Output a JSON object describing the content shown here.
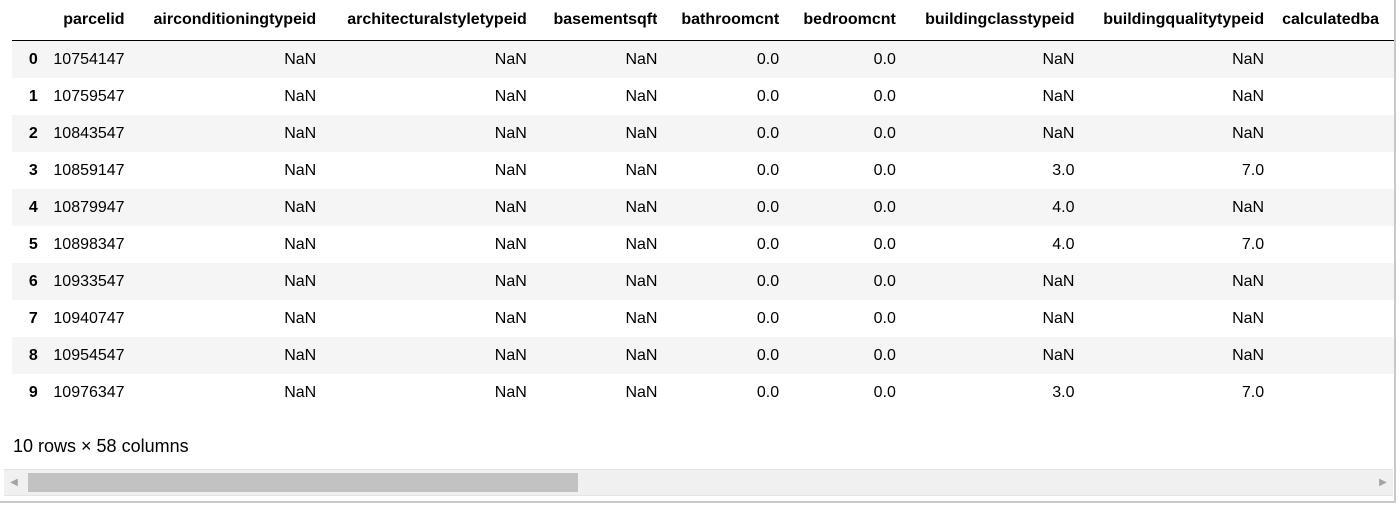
{
  "dataframe": {
    "columns": [
      "parcelid",
      "airconditioningtypeid",
      "architecturalstyletypeid",
      "basementsqft",
      "bathroomcnt",
      "bedroomcnt",
      "buildingclasstypeid",
      "buildingqualitytypeid",
      "calculatedba"
    ],
    "rows": [
      {
        "index": "0",
        "values": [
          "10754147",
          "NaN",
          "NaN",
          "NaN",
          "0.0",
          "0.0",
          "NaN",
          "NaN",
          ""
        ]
      },
      {
        "index": "1",
        "values": [
          "10759547",
          "NaN",
          "NaN",
          "NaN",
          "0.0",
          "0.0",
          "NaN",
          "NaN",
          ""
        ]
      },
      {
        "index": "2",
        "values": [
          "10843547",
          "NaN",
          "NaN",
          "NaN",
          "0.0",
          "0.0",
          "NaN",
          "NaN",
          ""
        ]
      },
      {
        "index": "3",
        "values": [
          "10859147",
          "NaN",
          "NaN",
          "NaN",
          "0.0",
          "0.0",
          "3.0",
          "7.0",
          ""
        ]
      },
      {
        "index": "4",
        "values": [
          "10879947",
          "NaN",
          "NaN",
          "NaN",
          "0.0",
          "0.0",
          "4.0",
          "NaN",
          ""
        ]
      },
      {
        "index": "5",
        "values": [
          "10898347",
          "NaN",
          "NaN",
          "NaN",
          "0.0",
          "0.0",
          "4.0",
          "7.0",
          ""
        ]
      },
      {
        "index": "6",
        "values": [
          "10933547",
          "NaN",
          "NaN",
          "NaN",
          "0.0",
          "0.0",
          "NaN",
          "NaN",
          ""
        ]
      },
      {
        "index": "7",
        "values": [
          "10940747",
          "NaN",
          "NaN",
          "NaN",
          "0.0",
          "0.0",
          "NaN",
          "NaN",
          ""
        ]
      },
      {
        "index": "8",
        "values": [
          "10954547",
          "NaN",
          "NaN",
          "NaN",
          "0.0",
          "0.0",
          "NaN",
          "NaN",
          ""
        ]
      },
      {
        "index": "9",
        "values": [
          "10976347",
          "NaN",
          "NaN",
          "NaN",
          "0.0",
          "0.0",
          "3.0",
          "7.0",
          ""
        ]
      }
    ],
    "shape_text": "10 rows × 58 columns"
  },
  "scrollbar": {
    "left_arrow_icon": "triangle-left-icon",
    "right_arrow_icon": "triangle-right-icon",
    "left_arrow_glyph": "◀",
    "right_arrow_glyph": "▶",
    "position_fraction": 0.0,
    "visible_fraction": 0.41
  }
}
